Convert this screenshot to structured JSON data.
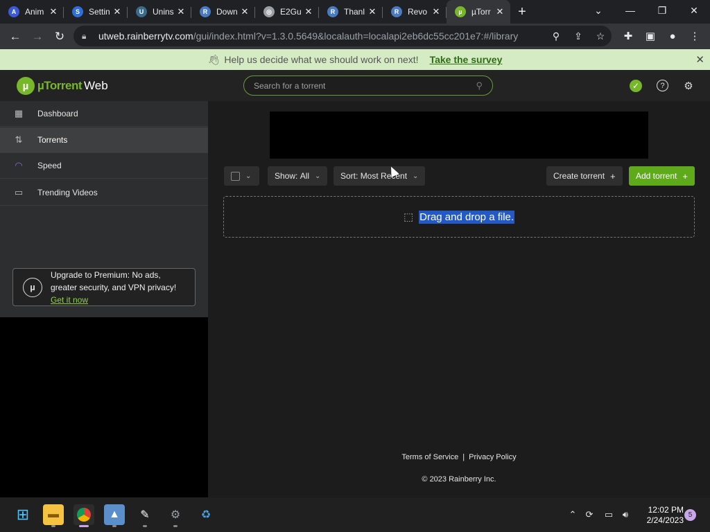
{
  "browser": {
    "tabs": [
      {
        "title": "Anim",
        "favicon_color": "#3b5bd6",
        "favicon_glyph": "A"
      },
      {
        "title": "Settin",
        "favicon_color": "#2f6fd8",
        "favicon_glyph": "S"
      },
      {
        "title": "Unins",
        "favicon_color": "#3a6b8a",
        "favicon_glyph": "U"
      },
      {
        "title": "Down",
        "favicon_color": "#4a7bc0",
        "favicon_glyph": "R"
      },
      {
        "title": "E2Gu",
        "favicon_color": "#9aa0a6",
        "favicon_glyph": "◎"
      },
      {
        "title": "Thanl",
        "favicon_color": "#4a7bc0",
        "favicon_glyph": "R"
      },
      {
        "title": "Revo",
        "favicon_color": "#4a7bc0",
        "favicon_glyph": "R"
      },
      {
        "title": "µTorr",
        "favicon_color": "#76b82a",
        "favicon_glyph": "µ",
        "active": true
      }
    ],
    "url_host": "utweb.rainberrytv.com",
    "url_path": "/gui/index.html?v=1.3.0.5649&localauth=localapi2eb6dc55cc201e7:#/library"
  },
  "banner": {
    "text": "Help us decide what we should work on next!",
    "link": "Take the survey"
  },
  "app": {
    "brand_name": "µTorrent",
    "brand_suffix": "Web",
    "search_placeholder": "Search for a torrent"
  },
  "sidebar": {
    "items": [
      {
        "label": "Dashboard",
        "icon": "dashboard-icon"
      },
      {
        "label": "Torrents",
        "icon": "torrents-icon",
        "active": true
      },
      {
        "label": "Speed",
        "icon": "speed-icon"
      },
      {
        "label": "Trending Videos",
        "icon": "trending-videos-icon"
      }
    ],
    "premium": {
      "text": "Upgrade to Premium: No ads, greater security, and VPN privacy!",
      "link": "Get it now"
    }
  },
  "toolbar": {
    "show_label": "Show:",
    "show_value": "All",
    "sort_label": "Sort:",
    "sort_value": "Most Recent",
    "create_label": "Create torrent",
    "add_label": "Add torrent"
  },
  "dropzone": {
    "text": "Drag and drop a file."
  },
  "footer": {
    "terms": "Terms of Service",
    "privacy": "Privacy Policy",
    "copyright": "© 2023 Rainberry Inc."
  },
  "taskbar": {
    "time": "12:02 PM",
    "date": "2/24/2023",
    "notification_count": "5"
  },
  "colors": {
    "accent": "#76b82a",
    "add_button": "#5eaa1a",
    "banner_bg": "#d4ebc4",
    "selection": "#2359c4"
  }
}
